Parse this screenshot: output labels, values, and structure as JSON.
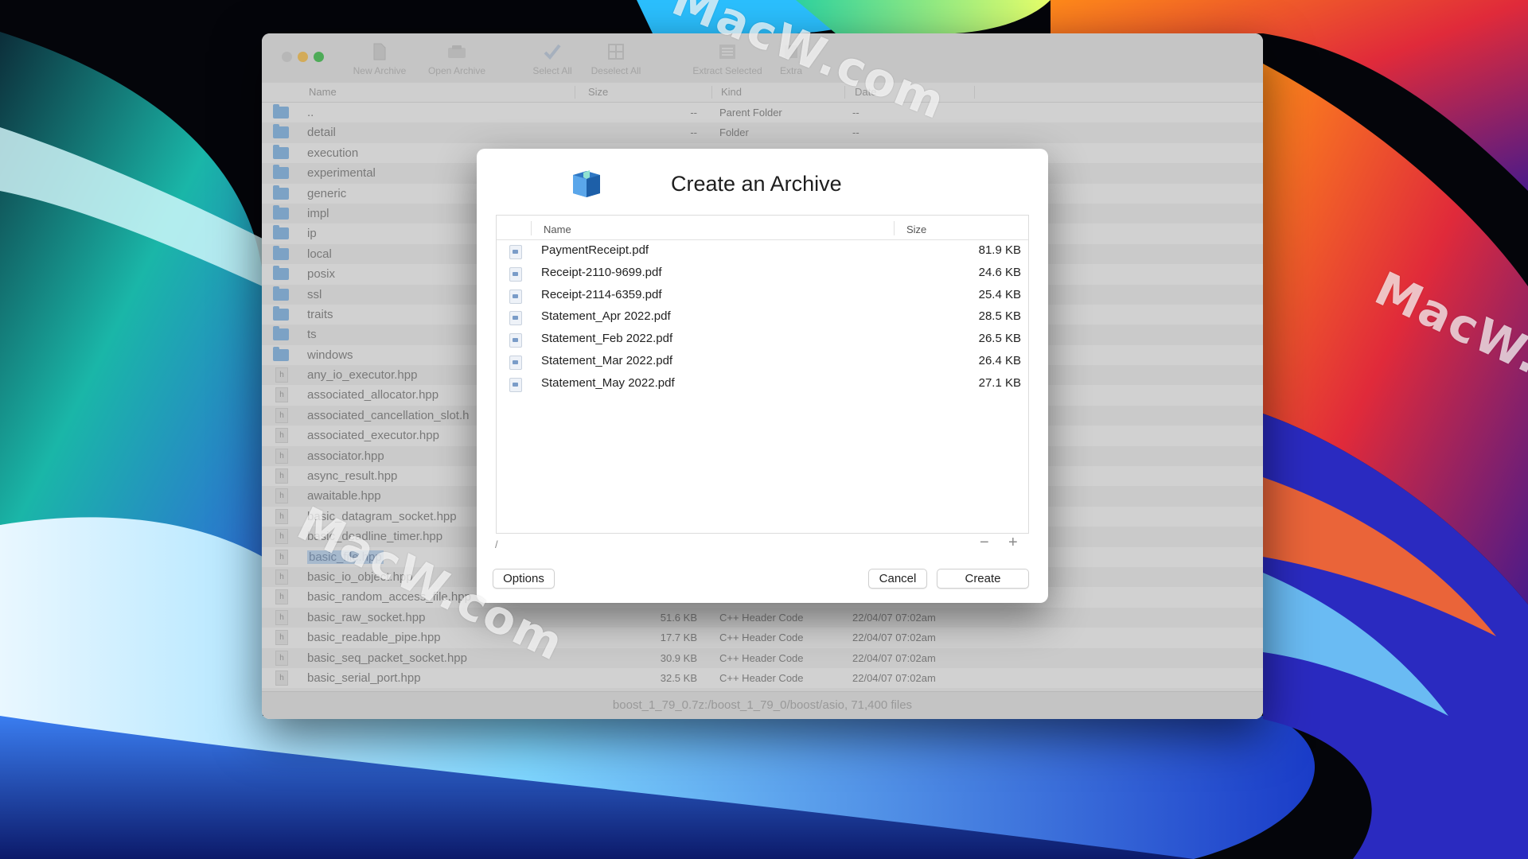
{
  "watermark": {
    "top": "MacW.com",
    "right": "MacW.c",
    "left": "MacW.com"
  },
  "window": {
    "toolbar": [
      {
        "label": "New Archive",
        "icon": "document-icon"
      },
      {
        "label": "Open Archive",
        "icon": "open-archive-icon"
      },
      {
        "label": "Select All",
        "icon": "checkmark-icon"
      },
      {
        "label": "Deselect All",
        "icon": "grid-icon"
      },
      {
        "label": "Extract Selected",
        "icon": "list-icon"
      },
      {
        "label": "Extra",
        "icon": "extract-icon"
      }
    ],
    "columns": {
      "name": "Name",
      "size": "Size",
      "kind": "Kind",
      "date": "Date"
    },
    "rows": [
      {
        "name": "..",
        "size": "--",
        "kind": "Parent Folder",
        "date": "--",
        "type": "folder"
      },
      {
        "name": "detail",
        "size": "--",
        "kind": "Folder",
        "date": "--",
        "type": "folder"
      },
      {
        "name": "execution",
        "size": "",
        "kind": "",
        "date": "",
        "type": "folder"
      },
      {
        "name": "experimental",
        "size": "",
        "kind": "",
        "date": "",
        "type": "folder"
      },
      {
        "name": "generic",
        "size": "",
        "kind": "",
        "date": "",
        "type": "folder"
      },
      {
        "name": "impl",
        "size": "",
        "kind": "",
        "date": "",
        "type": "folder"
      },
      {
        "name": "ip",
        "size": "",
        "kind": "",
        "date": "",
        "type": "folder"
      },
      {
        "name": "local",
        "size": "",
        "kind": "",
        "date": "",
        "type": "folder"
      },
      {
        "name": "posix",
        "size": "",
        "kind": "",
        "date": "",
        "type": "folder"
      },
      {
        "name": "ssl",
        "size": "",
        "kind": "",
        "date": "",
        "type": "folder"
      },
      {
        "name": "traits",
        "size": "",
        "kind": "",
        "date": "",
        "type": "folder"
      },
      {
        "name": "ts",
        "size": "",
        "kind": "",
        "date": "",
        "type": "folder"
      },
      {
        "name": "windows",
        "size": "",
        "kind": "",
        "date": "",
        "type": "folder"
      },
      {
        "name": "any_io_executor.hpp",
        "size": "",
        "kind": "",
        "date": "",
        "type": "file"
      },
      {
        "name": "associated_allocator.hpp",
        "size": "",
        "kind": "",
        "date": "",
        "type": "file"
      },
      {
        "name": "associated_cancellation_slot.h",
        "size": "",
        "kind": "",
        "date": "",
        "type": "file"
      },
      {
        "name": "associated_executor.hpp",
        "size": "",
        "kind": "",
        "date": "",
        "type": "file"
      },
      {
        "name": "associator.hpp",
        "size": "",
        "kind": "",
        "date": "",
        "type": "file"
      },
      {
        "name": "async_result.hpp",
        "size": "",
        "kind": "",
        "date": "",
        "type": "file"
      },
      {
        "name": "awaitable.hpp",
        "size": "",
        "kind": "",
        "date": "",
        "type": "file"
      },
      {
        "name": "basic_datagram_socket.hpp",
        "size": "",
        "kind": "",
        "date": "",
        "type": "file"
      },
      {
        "name": "basic_deadline_timer.hpp",
        "size": "",
        "kind": "",
        "date": "",
        "type": "file"
      },
      {
        "name": "basic_file.hpp",
        "size": "",
        "kind": "",
        "date": "",
        "type": "file",
        "selected": true
      },
      {
        "name": "basic_io_object.hpp",
        "size": "",
        "kind": "",
        "date": "",
        "type": "file"
      },
      {
        "name": "basic_random_access_file.hpp",
        "size": "",
        "kind": "",
        "date": "",
        "type": "file"
      },
      {
        "name": "basic_raw_socket.hpp",
        "size": "51.6 KB",
        "kind": "C++ Header Code",
        "date": "22/04/07 07:02am",
        "type": "file"
      },
      {
        "name": "basic_readable_pipe.hpp",
        "size": "17.7 KB",
        "kind": "C++ Header Code",
        "date": "22/04/07 07:02am",
        "type": "file"
      },
      {
        "name": "basic_seq_packet_socket.hpp",
        "size": "30.9 KB",
        "kind": "C++ Header Code",
        "date": "22/04/07 07:02am",
        "type": "file"
      },
      {
        "name": "basic_serial_port.hpp",
        "size": "32.5 KB",
        "kind": "C++ Header Code",
        "date": "22/04/07 07:02am",
        "type": "file"
      }
    ],
    "status": "boost_1_79_0.7z:/boost_1_79_0/boost/asio, 71,400 files"
  },
  "dialog": {
    "title": "Create an Archive",
    "columns": {
      "name": "Name",
      "size": "Size"
    },
    "files": [
      {
        "name": "PaymentReceipt.pdf",
        "size": "81.9 KB"
      },
      {
        "name": "Receipt-2110-9699.pdf",
        "size": "24.6 KB"
      },
      {
        "name": "Receipt-2114-6359.pdf",
        "size": "25.4 KB"
      },
      {
        "name": "Statement_Apr 2022.pdf",
        "size": "28.5 KB"
      },
      {
        "name": "Statement_Feb 2022.pdf",
        "size": "26.5 KB"
      },
      {
        "name": "Statement_Mar 2022.pdf",
        "size": "26.4 KB"
      },
      {
        "name": "Statement_May 2022.pdf",
        "size": "27.1 KB"
      }
    ],
    "path": "/",
    "minus": "−",
    "plus": "+",
    "options_label": "Options",
    "cancel_label": "Cancel",
    "create_label": "Create"
  }
}
